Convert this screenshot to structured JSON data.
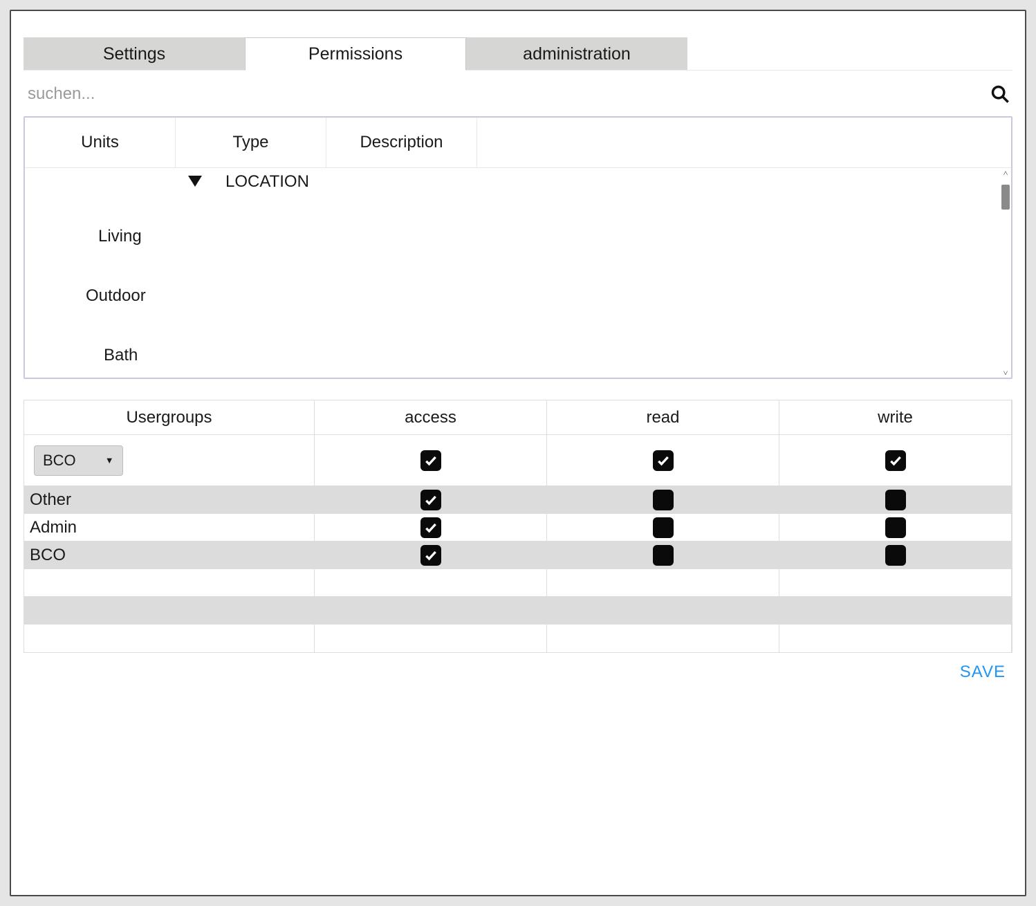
{
  "tabs": [
    {
      "label": "Settings",
      "active": false
    },
    {
      "label": "Permissions",
      "active": true
    },
    {
      "label": "administration",
      "active": false
    }
  ],
  "search": {
    "placeholder": "suchen..."
  },
  "tree": {
    "headers": {
      "units": "Units",
      "type": "Type",
      "description": "Description"
    },
    "group_label": "LOCATION",
    "items": [
      {
        "label": "Living"
      },
      {
        "label": "Outdoor"
      },
      {
        "label": "Bath"
      }
    ]
  },
  "permissions": {
    "headers": {
      "usergroups": "Usergroups",
      "access": "access",
      "read": "read",
      "write": "write"
    },
    "dropdown_selected": "BCO",
    "rows": [
      {
        "name": "",
        "is_dropdown": true,
        "access": true,
        "read": true,
        "write": true
      },
      {
        "name": "Other",
        "access": true,
        "read": false,
        "write": false
      },
      {
        "name": "Admin",
        "access": true,
        "read": false,
        "write": false
      },
      {
        "name": "BCO",
        "access": true,
        "read": false,
        "write": false
      }
    ]
  },
  "footer": {
    "save_label": "SAVE"
  }
}
